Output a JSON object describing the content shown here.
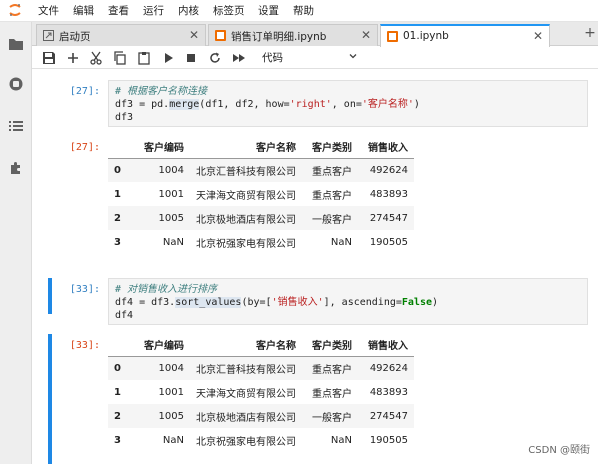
{
  "menubar": {
    "logo": "jupyter-logo",
    "items": [
      "文件",
      "编辑",
      "查看",
      "运行",
      "内核",
      "标签页",
      "设置",
      "帮助"
    ]
  },
  "sidebar": {
    "icons": [
      "folder-icon",
      "running-icon",
      "toc-icon",
      "extension-icon"
    ]
  },
  "tabs": [
    {
      "label": "启动页",
      "active": false
    },
    {
      "label": "销售订单明细.ipynb",
      "active": false
    },
    {
      "label": "01.ipynb",
      "active": true
    }
  ],
  "toolbar": {
    "cell_type": "代码",
    "icons": [
      "save-icon",
      "add-icon",
      "cut-icon",
      "copy-icon",
      "paste-icon",
      "run-icon",
      "stop-icon",
      "restart-icon",
      "fast-forward-icon"
    ]
  },
  "cells": [
    {
      "in_prompt": "[27]:",
      "out_prompt": "[27]:",
      "code_comment": "# 根据客户名称连接",
      "code_line2_prefix": "df3 = pd.",
      "code_line2_fn": "merge",
      "code_line2_args_a": "(df1, df2, how=",
      "code_line2_str1": "'right'",
      "code_line2_args_b": ", on=",
      "code_line2_str2": "'客户名称'",
      "code_line2_end": ")",
      "code_line3": "df3",
      "columns": [
        "",
        "客户编码",
        "客户名称",
        "客户类别",
        "销售收入"
      ],
      "rows": [
        [
          "0",
          "1004",
          "北京汇普科技有限公司",
          "重点客户",
          "492624"
        ],
        [
          "1",
          "1001",
          "天津海文商贸有限公司",
          "重点客户",
          "483893"
        ],
        [
          "2",
          "1005",
          "北京极地酒店有限公司",
          "一般客户",
          "274547"
        ],
        [
          "3",
          "NaN",
          "北京祝强家电有限公司",
          "NaN",
          "190505"
        ]
      ]
    },
    {
      "in_prompt": "[33]:",
      "out_prompt": "[33]:",
      "code_comment": "# 对销售收入进行排序",
      "code_line2_prefix": "df4 = df3.",
      "code_line2_fn": "sort_values",
      "code_line2_args_a": "(by=[",
      "code_line2_str1": "'销售收入'",
      "code_line2_args_b": "], ascending=",
      "code_line2_kw": "False",
      "code_line2_end": ")",
      "code_line3": "df4",
      "columns": [
        "",
        "客户编码",
        "客户名称",
        "客户类别",
        "销售收入"
      ],
      "rows": [
        [
          "0",
          "1004",
          "北京汇普科技有限公司",
          "重点客户",
          "492624"
        ],
        [
          "1",
          "1001",
          "天津海文商贸有限公司",
          "重点客户",
          "483893"
        ],
        [
          "2",
          "1005",
          "北京极地酒店有限公司",
          "一般客户",
          "274547"
        ],
        [
          "3",
          "NaN",
          "北京祝强家电有限公司",
          "NaN",
          "190505"
        ]
      ]
    }
  ],
  "watermark": "CSDN @颐街",
  "colors": {
    "accent": "#2196f3",
    "cell_active": "#1e88e5",
    "in_prompt": "#307fc1",
    "out_prompt": "#d84315"
  }
}
